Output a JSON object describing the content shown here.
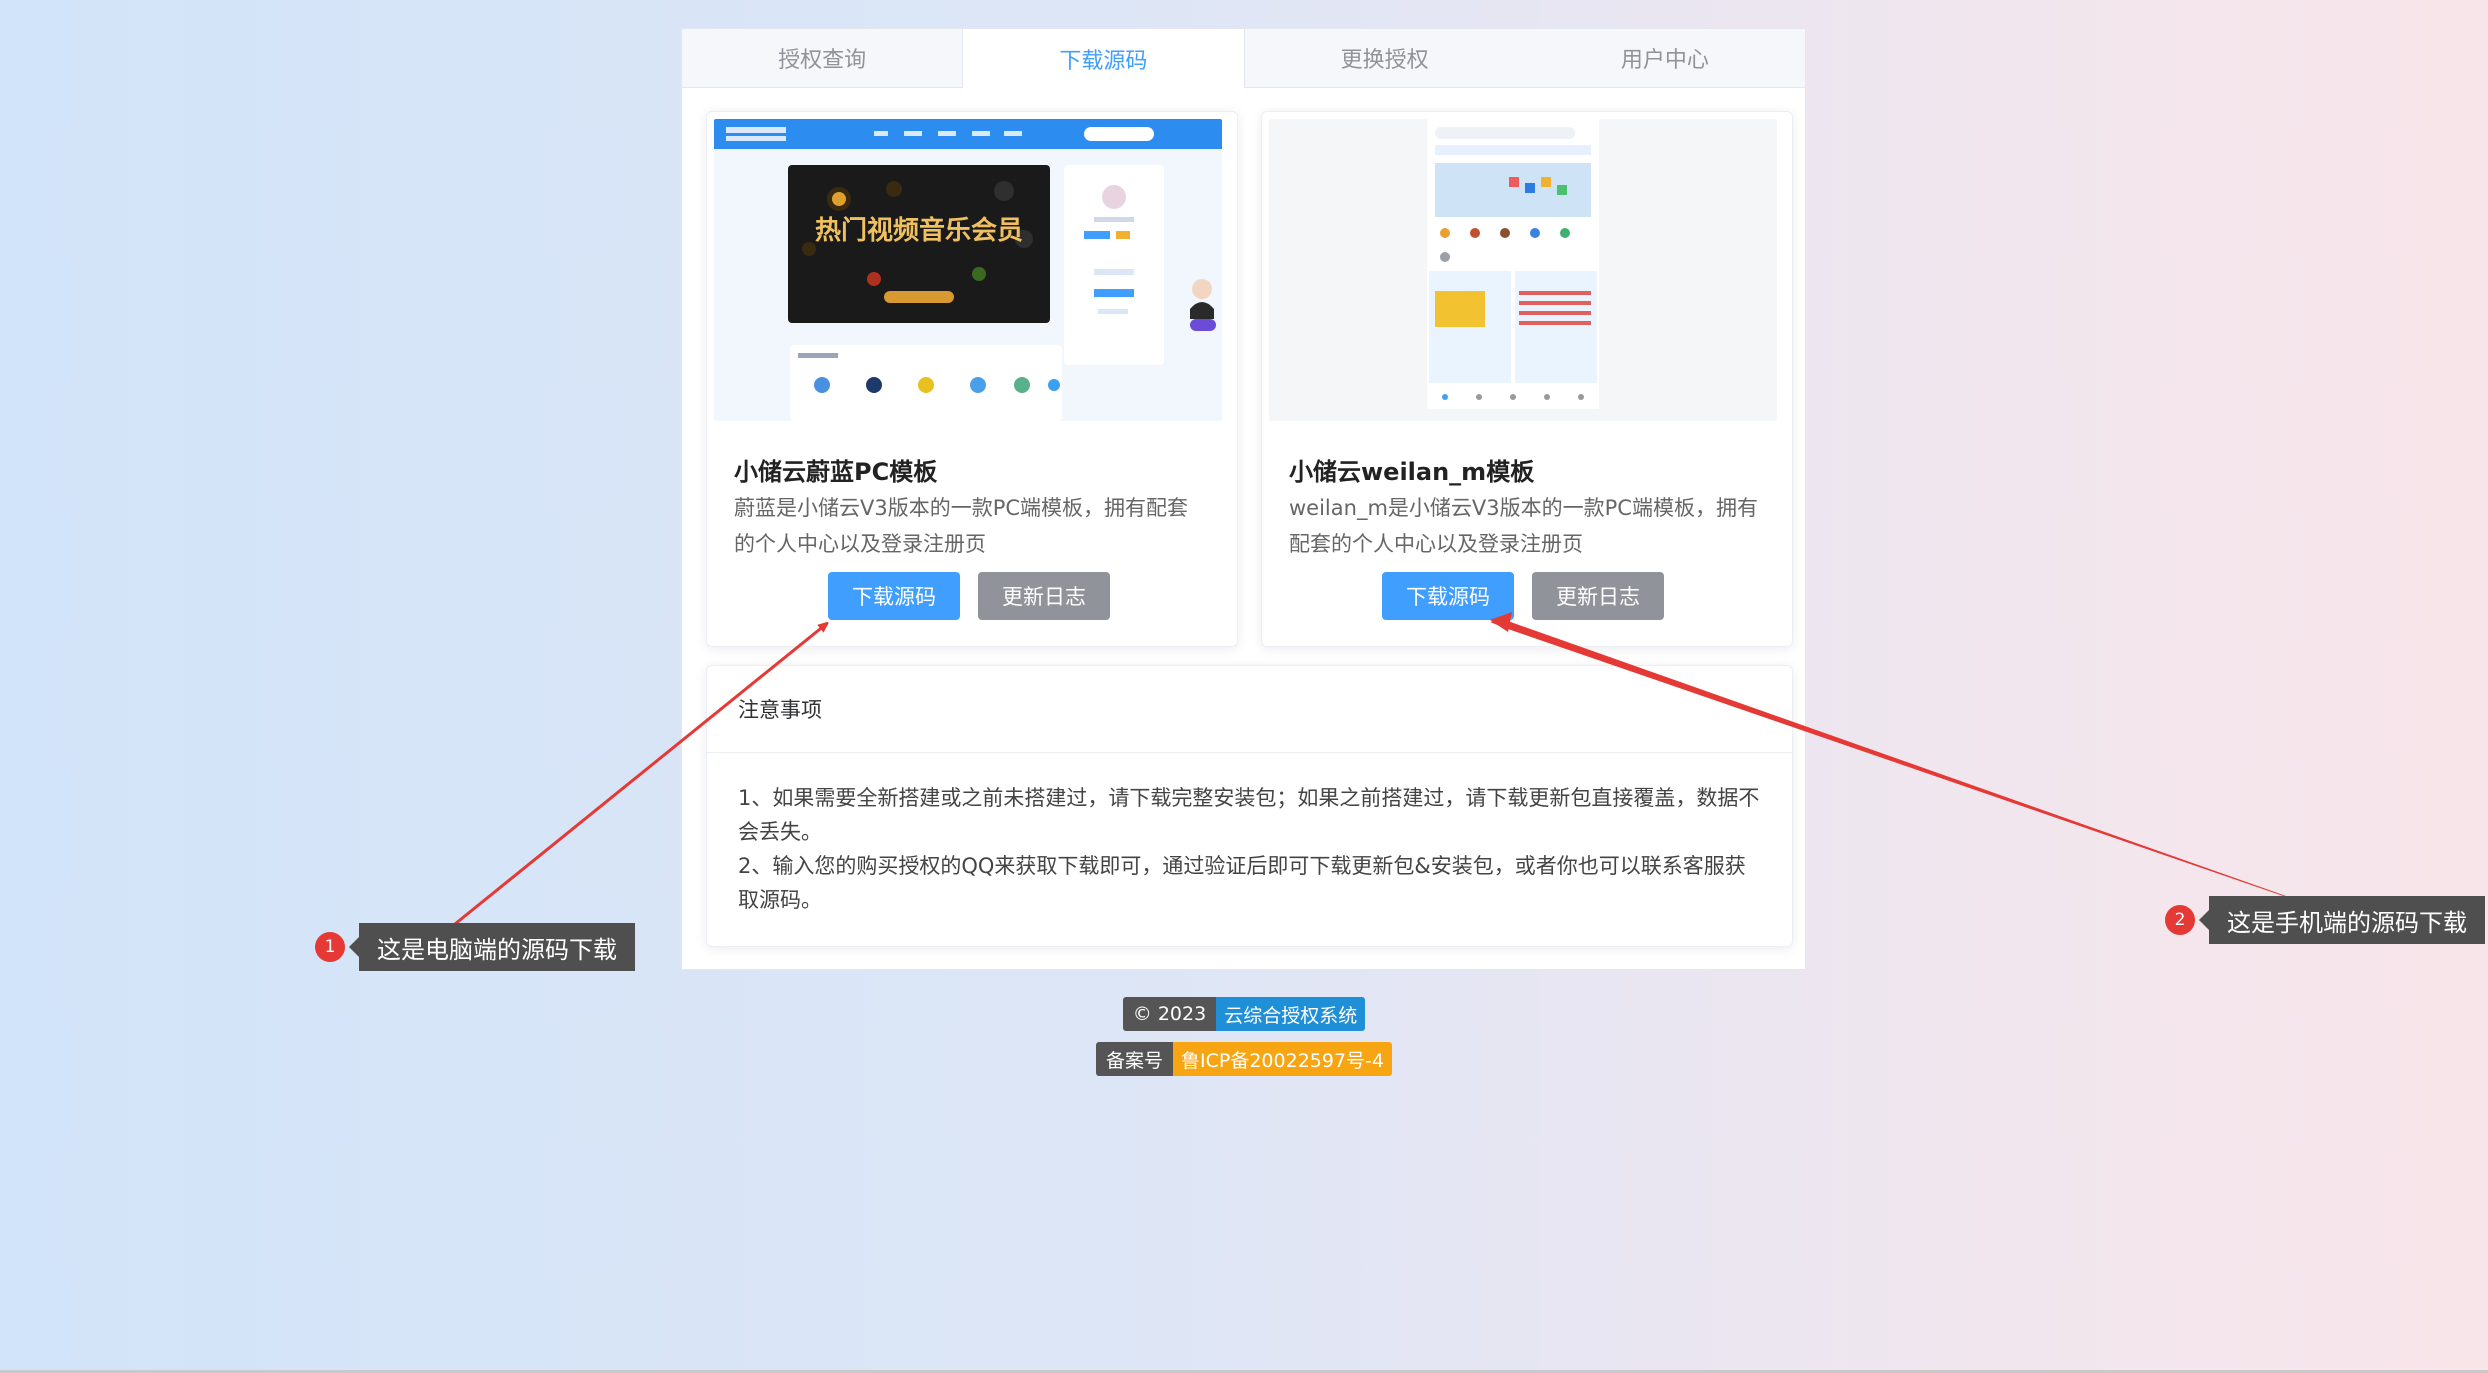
{
  "tabs": [
    {
      "label": "授权查询"
    },
    {
      "label": "下载源码",
      "active": true
    },
    {
      "label": "更换授权"
    },
    {
      "label": "用户中心"
    }
  ],
  "templates": [
    {
      "title": "小储云蔚蓝PC模板",
      "description": "蔚蓝是小储云V3版本的一款PC端模板，拥有配套的个人中心以及登录注册页",
      "preview_banner_text": "热门视频音乐会员",
      "download_label": "下载源码",
      "changelog_label": "更新日志"
    },
    {
      "title": "小储云weilan_m模板",
      "description": "weilan_m是小储云V3版本的一款PC端模板，拥有配套的个人中心以及登录注册页",
      "download_label": "下载源码",
      "changelog_label": "更新日志"
    }
  ],
  "notice": {
    "title": "注意事项",
    "lines": [
      "1、如果需要全新搭建或之前未搭建过，请下载完整安装包；如果之前搭建过，请下载更新包直接覆盖，数据不会丢失。",
      "2、输入您的购买授权的QQ来获取下载即可，通过验证后即可下载更新包&安装包，或者你也可以联系客服获取源码。"
    ]
  },
  "footer": {
    "copyright_left": "© 2023",
    "copyright_right": "云综合授权系统",
    "icp_left": "备案号",
    "icp_right": "鲁ICP备20022597号-4",
    "copyright_color": "#1f8fd8",
    "icp_color": "#f8a514"
  },
  "annotations": [
    {
      "number": "1",
      "text": "这是电脑端的源码下载"
    },
    {
      "number": "2",
      "text": "这是手机端的源码下载"
    }
  ],
  "colors": {
    "accent": "#409eff",
    "secondary_button": "#909399",
    "arrow": "#e53935"
  }
}
